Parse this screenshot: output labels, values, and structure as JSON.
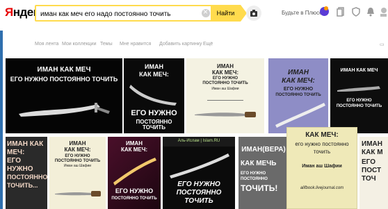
{
  "logo": {
    "first": "Я",
    "rest": "ндекс"
  },
  "search": {
    "query": "иман как меч его надо постоянно точить",
    "button_label": "Найти"
  },
  "header": {
    "plus_link": "Будьте в Плюсе"
  },
  "filters": {
    "items": [
      "Моя лента",
      "Мои коллекции",
      "Темы",
      "Мне нравится",
      "Добавить картинку",
      "Ещё"
    ],
    "right": "▭"
  },
  "images": {
    "t1": {
      "line1": "ИМАН КАК МЕЧ",
      "line2": "ЕГО НУЖНО ПОСТОЯННО ТОЧИТЬ"
    },
    "t2": {
      "line1": "ИМАН",
      "line2": "КАК МЕЧ:",
      "line3": "ЕГО НУЖНО",
      "line4": "ПОСТОЯННО ТОЧИТЬ"
    },
    "t3": {
      "line1": "ИМАН",
      "line2": "КАК МЕЧ:",
      "line3": "ЕГО НУЖНО",
      "line4": "ПОСТОЯННО ТОЧИТЬ",
      "line5": "Иман аш Шафии"
    },
    "t4": {
      "line1": "ИМАН",
      "line2": "КАК МЕЧ:",
      "line3": "ЕГО НУЖНО",
      "line4": "ПОСТОЯННО ТОЧИТЬ"
    },
    "t5": {
      "line1": "ИМАН КАК МЕЧ",
      "line2": "ЕГО НУЖНО",
      "line3": "ПОСТОЯННО ТОЧИТЬ"
    },
    "t6": {
      "line1": "ИМАН КАК",
      "line2": "МЕЧ:",
      "line3": "ЕГО",
      "line4": "НУЖНО",
      "line5": "ПОСТОЯННО",
      "line6": "ТОЧИТЬ..."
    },
    "t7": {
      "line1": "ИМАН",
      "line2": "КАК МЕЧ:",
      "line3": "ЕГО НУЖНО",
      "line4": "ПОСТОЯННО ТОЧИТЬ",
      "line5": "Иман аш Шафии"
    },
    "t8": {
      "line1": "ИМАН",
      "line2": "КАК МЕЧ:",
      "line3": "ЕГО НУЖНО",
      "line4": "ПОСТОЯННО ТОЧИТЬ"
    },
    "t9": {
      "header": "Аль-Ислам | Islam.RU",
      "line1": "ЕГО НУЖНО",
      "line2": "ПОСТОЯННО",
      "line3": "ТОЧИТЬ"
    },
    "t10": {
      "line1": "ИМАН(ВЕРА)",
      "line2": "КАК МЕЧЬ",
      "line3": "ЕГО НУЖНО",
      "line4": "ПОСТОЯННО",
      "line5": "ТОЧИТЬ!"
    },
    "t11": {
      "line1": "КАК МЕЧ:",
      "line2": "его нужно постоянно",
      "line3": "точить",
      "line4": "Иман аш Шафии",
      "line5": "alifbook.livejournal.com"
    },
    "t12": {
      "line1": "ИМАН",
      "line2": "КАК М",
      "line3": "ЕГО",
      "line4": "ПОСТ",
      "line5": "ТОЧ"
    }
  }
}
